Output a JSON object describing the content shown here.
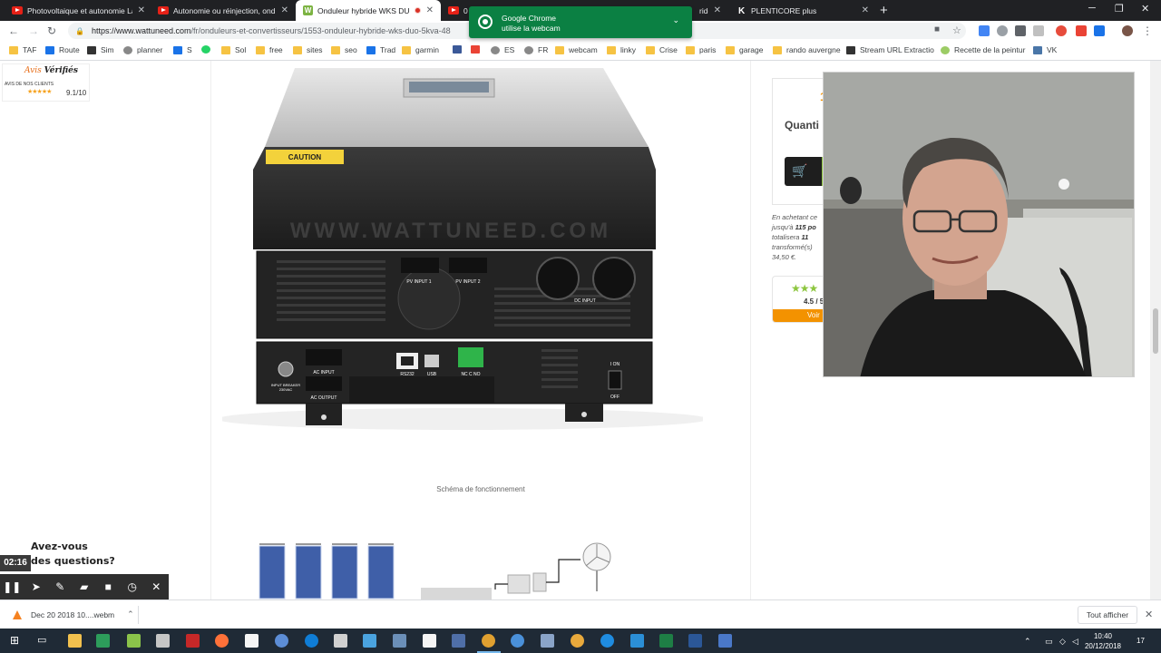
{
  "tabs": [
    {
      "label": "Photovoltaique et autonomie La",
      "icon": "youtube-icon"
    },
    {
      "label": "Autonomie ou réinjection, ondul",
      "icon": "youtube-icon"
    },
    {
      "label": "Onduleur hybride WKS DUO",
      "icon": "wattuneed-icon",
      "active": true
    },
    {
      "label": "0 s",
      "icon": "youtube-icon"
    },
    {
      "label": "ride",
      "icon": "youtube-icon"
    },
    {
      "label": "PLENTICORE plus",
      "icon": "k-icon"
    }
  ],
  "address": {
    "host": "https://www.wattuneed.com",
    "path": "/fr/onduleurs-et-convertisseurs/1553-onduleur-hybride-wks-duo-5kva-48"
  },
  "notification": {
    "title": "Google Chrome",
    "subtitle": "utilise la webcam"
  },
  "bookmarks": [
    {
      "label": "TAF",
      "icon": "folder"
    },
    {
      "label": "Route",
      "icon": "route"
    },
    {
      "label": "Sim",
      "icon": "dark"
    },
    {
      "label": "planner",
      "icon": "round"
    },
    {
      "label": "S",
      "icon": "blue"
    },
    {
      "label": "",
      "icon": "whatsapp"
    },
    {
      "label": "Sol",
      "icon": "folder"
    },
    {
      "label": "free",
      "icon": "folder"
    },
    {
      "label": "sites",
      "icon": "folder"
    },
    {
      "label": "seo",
      "icon": "folder"
    },
    {
      "label": "Trad",
      "icon": "blue"
    },
    {
      "label": "garmin",
      "icon": "folder"
    },
    {
      "label": "",
      "icon": "facebook"
    },
    {
      "label": "",
      "icon": "gmail"
    },
    {
      "label": "ES",
      "icon": "google"
    },
    {
      "label": "FR",
      "icon": "google"
    },
    {
      "label": "webcam",
      "icon": "folder"
    },
    {
      "label": "linky",
      "icon": "folder"
    },
    {
      "label": "Crise",
      "icon": "folder"
    },
    {
      "label": "paris",
      "icon": "folder"
    },
    {
      "label": "garage",
      "icon": "folder"
    },
    {
      "label": "rando auvergne",
      "icon": "folder"
    },
    {
      "label": "Stream URL Extractio",
      "icon": "dark"
    },
    {
      "label": "Recette de la peintur",
      "icon": "lime"
    },
    {
      "label": "VK",
      "icon": "vk"
    }
  ],
  "avis": {
    "brand_a": "Avis",
    "brand_b": "Vérifiés",
    "tagline": "AVIS DE NOS CLIENTS",
    "stars": "★★★★★",
    "score": "9.1/10"
  },
  "product": {
    "caution": "CAUTION",
    "watermark": "WWW.WATTUNEED.COM",
    "pv1": "PV INPUT 1",
    "pv2": "PV INPUT 2",
    "dc": "DC  INPUT",
    "ac_in": "AC INPUT",
    "ac_out": "AC OUTPUT",
    "breaker": "INPUT BREAKER",
    "breaker2": "230VAC",
    "rs232": "RS232",
    "usb": "USB",
    "nc": "NC C NO",
    "on": "I  ON",
    "off": "OFF"
  },
  "caption": "Schéma de fonctionnement",
  "panel": {
    "price": "1",
    "quantity": "Quanti",
    "promo_1": "En achetant ce",
    "promo_2a": "jusqu'à",
    "promo_2b": "115 po",
    "promo_3a": "totalisera",
    "promo_3b": "11",
    "promo_4": "transformé(s)",
    "promo_5": "34,50 €.",
    "stars": "★★★",
    "rating": "4.5 / 5",
    "more": "Voir"
  },
  "recorder": {
    "speech_1": "Avez-vous",
    "speech_2": "des questions?",
    "time": "02:16"
  },
  "download": {
    "filename": "Dec 20 2018 10....webm",
    "show_all": "Tout afficher"
  },
  "clock": {
    "time": "10:40",
    "date": "20/12/2018"
  },
  "notifications_count": "17",
  "colors": {
    "accent_orange": "#f39200",
    "accent_green": "#8dc63f",
    "notification_green": "#0b8043"
  }
}
